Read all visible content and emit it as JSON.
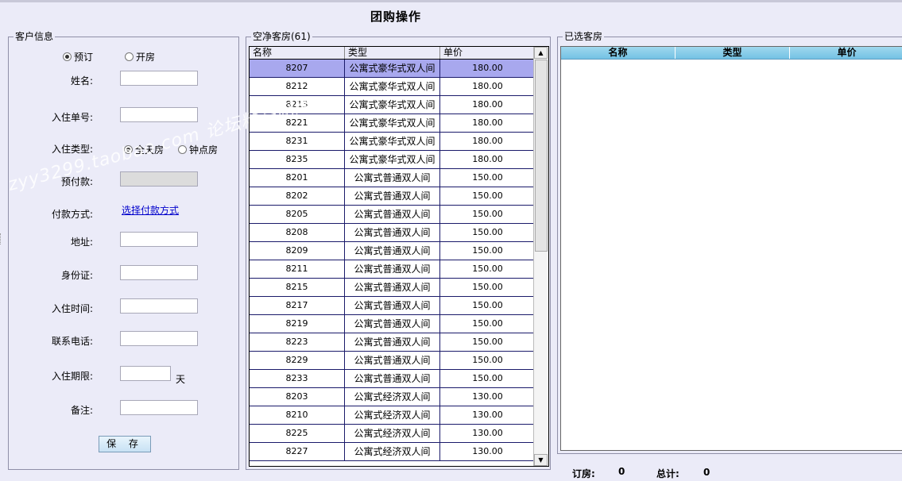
{
  "title": "团购操作",
  "customer": {
    "legend": "客户信息",
    "mode_reserve": "预订",
    "mode_checkin": "开房",
    "name_label": "姓名:",
    "order_no_label": "入住单号:",
    "stay_type_label": "入住类型:",
    "stay_full": "全天房",
    "stay_hourly": "钟点房",
    "deposit_label": "预付款:",
    "payment_label": "付款方式:",
    "payment_link": "选择付款方式",
    "address_label": "地址:",
    "id_label": "身份证:",
    "checkin_time_label": "入住时间:",
    "phone_label": "联系电话:",
    "period_label": "入住期限:",
    "period_unit": "天",
    "remark_label": "备注:",
    "save_label": "保 存"
  },
  "vacant": {
    "legend": "空净客房(61)",
    "columns": [
      "名称",
      "类型",
      "单价"
    ],
    "rows": [
      {
        "name": "8207",
        "type": "公寓式豪华式双人间",
        "price": "180.00",
        "selected": true
      },
      {
        "name": "8212",
        "type": "公寓式豪华式双人间",
        "price": "180.00"
      },
      {
        "name": "8213",
        "type": "公寓式豪华式双人间",
        "price": "180.00"
      },
      {
        "name": "8221",
        "type": "公寓式豪华式双人间",
        "price": "180.00"
      },
      {
        "name": "8231",
        "type": "公寓式豪华式双人间",
        "price": "180.00"
      },
      {
        "name": "8235",
        "type": "公寓式豪华式双人间",
        "price": "180.00"
      },
      {
        "name": "8201",
        "type": "公寓式普通双人间",
        "price": "150.00"
      },
      {
        "name": "8202",
        "type": "公寓式普通双人间",
        "price": "150.00"
      },
      {
        "name": "8205",
        "type": "公寓式普通双人间",
        "price": "150.00"
      },
      {
        "name": "8208",
        "type": "公寓式普通双人间",
        "price": "150.00"
      },
      {
        "name": "8209",
        "type": "公寓式普通双人间",
        "price": "150.00"
      },
      {
        "name": "8211",
        "type": "公寓式普通双人间",
        "price": "150.00"
      },
      {
        "name": "8215",
        "type": "公寓式普通双人间",
        "price": "150.00"
      },
      {
        "name": "8217",
        "type": "公寓式普通双人间",
        "price": "150.00"
      },
      {
        "name": "8219",
        "type": "公寓式普通双人间",
        "price": "150.00"
      },
      {
        "name": "8223",
        "type": "公寓式普通双人间",
        "price": "150.00"
      },
      {
        "name": "8229",
        "type": "公寓式普通双人间",
        "price": "150.00"
      },
      {
        "name": "8233",
        "type": "公寓式普通双人间",
        "price": "150.00"
      },
      {
        "name": "8203",
        "type": "公寓式经济双人间",
        "price": "130.00"
      },
      {
        "name": "8210",
        "type": "公寓式经济双人间",
        "price": "130.00"
      },
      {
        "name": "8225",
        "type": "公寓式经济双人间",
        "price": "130.00"
      },
      {
        "name": "8227",
        "type": "公寓式经济双人间",
        "price": "130.00"
      }
    ]
  },
  "selected_rooms": {
    "legend": "已选客房",
    "columns": [
      "名称",
      "类型",
      "单价"
    ]
  },
  "summary": {
    "booked_label": "订房:",
    "booked_value": "0",
    "total_label": "总计:",
    "total_value": "0"
  },
  "watermark": "zyy3299.taobao.com  论坛精品网络"
}
